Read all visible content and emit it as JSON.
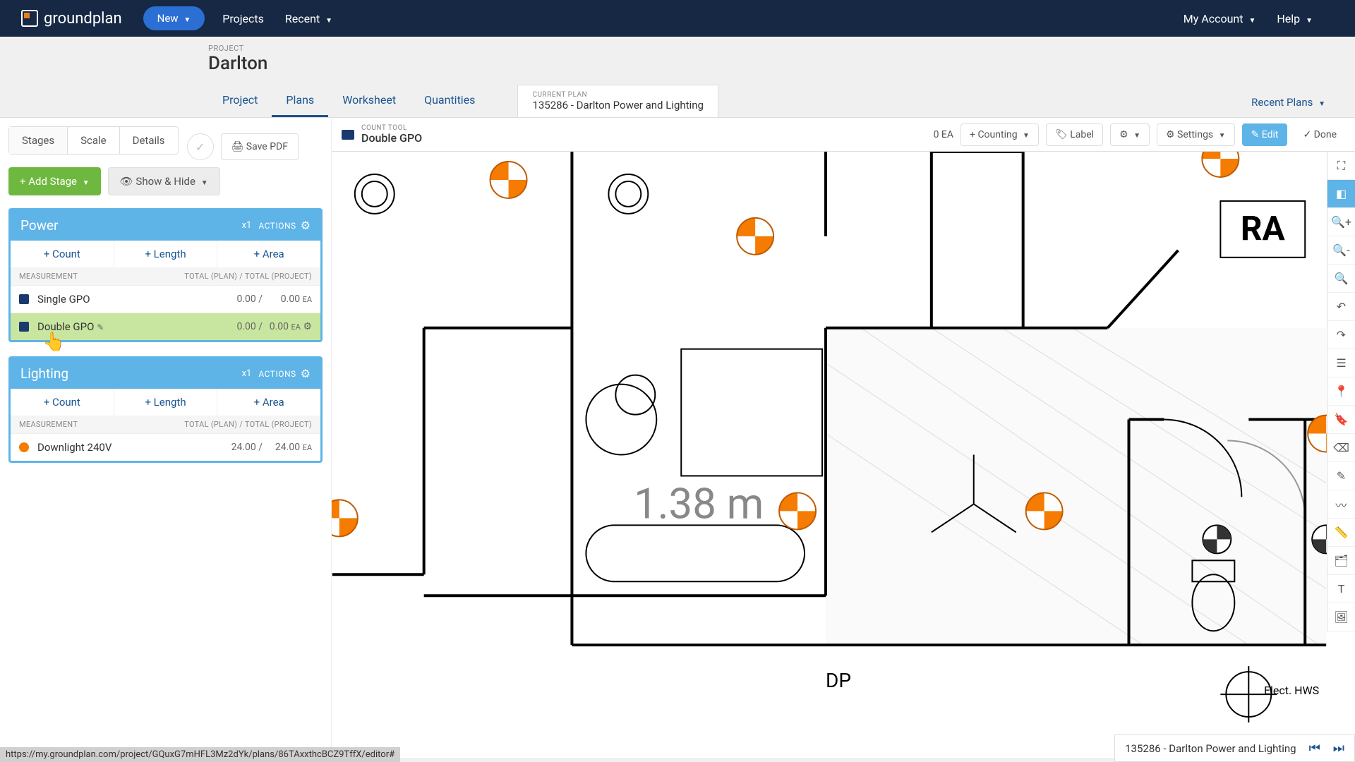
{
  "nav": {
    "brand": "groundplan",
    "new": "New",
    "projects": "Projects",
    "recent": "Recent",
    "account": "My Account",
    "help": "Help"
  },
  "project": {
    "label": "PROJECT",
    "name": "Darlton"
  },
  "mainTabs": {
    "project": "Project",
    "plans": "Plans",
    "worksheet": "Worksheet",
    "quantities": "Quantities"
  },
  "currentPlan": {
    "label": "CURRENT PLAN",
    "name": "135286 - Darlton Power and Lighting"
  },
  "recentPlans": "Recent Plans",
  "sideTabs": {
    "stages": "Stages",
    "scale": "Scale",
    "details": "Details"
  },
  "savePdf": "Save PDF",
  "addStage": "Add Stage",
  "showHide": "Show & Hide",
  "measHead": {
    "left": "MEASUREMENT",
    "right": "TOTAL (PLAN) / TOTAL (PROJECT)"
  },
  "addBtns": {
    "count": "Count",
    "length": "Length",
    "area": "Area"
  },
  "stages": [
    {
      "title": "Power",
      "mult": "x1",
      "actions": "ACTIONS",
      "rows": [
        {
          "name": "Single GPO",
          "plan": "0.00",
          "proj": "0.00",
          "unit": "EA",
          "icon": "blue",
          "selected": false
        },
        {
          "name": "Double GPO",
          "plan": "0.00",
          "proj": "0.00",
          "unit": "EA",
          "icon": "blue",
          "selected": true
        }
      ]
    },
    {
      "title": "Lighting",
      "mult": "x1",
      "actions": "ACTIONS",
      "rows": [
        {
          "name": "Downlight 240V",
          "plan": "24.00",
          "proj": "24.00",
          "unit": "EA",
          "icon": "orange",
          "selected": false
        }
      ]
    }
  ],
  "countTool": {
    "label": "COUNT TOOL",
    "name": "Double GPO"
  },
  "toolbar": {
    "ea": "0 EA",
    "counting": "Counting",
    "label": "Label",
    "settings": "Settings",
    "edit": "Edit",
    "done": "Done"
  },
  "floorplan": {
    "dim": "1.38 m",
    "ra": "RA",
    "dp": "DP",
    "elect": "Elect. HWS"
  },
  "statusUrl": "https://my.groundplan.com/project/GQuxG7mHFL3Mz2dYk/plans/86TAxxthcBCZ9TffX/editor#",
  "statusPlan": "135286 - Darlton Power and Lighting"
}
